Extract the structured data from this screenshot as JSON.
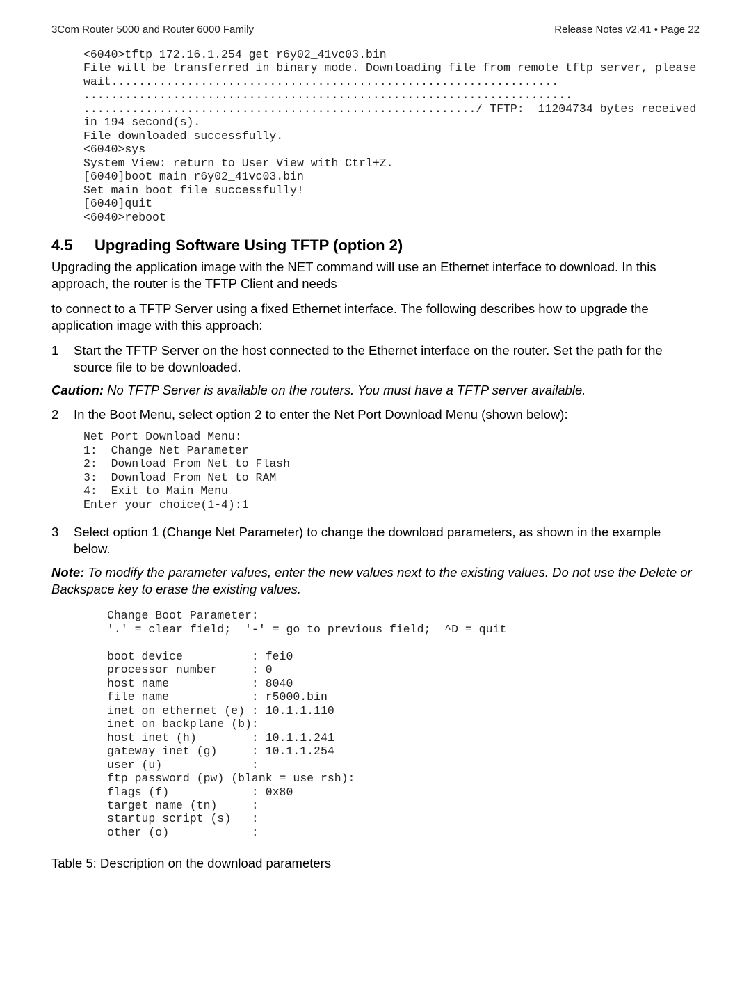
{
  "header": {
    "left": "3Com Router 5000 and Router 6000 Family",
    "right": "Release Notes v2.41 • Page 22"
  },
  "codeblock1": "<6040>tftp 172.16.1.254 get r6y02_41vc03.bin\nFile will be transferred in binary mode. Downloading file from remote tftp server, please wait.................................................................\n.......................................................................\n........................................................./ TFTP:  11204734 bytes received in 194 second(s).\nFile downloaded successfully.\n<6040>sys\nSystem View: return to User View with Ctrl+Z.\n[6040]boot main r6y02_41vc03.bin\nSet main boot file successfully!\n[6040]quit\n<6040>reboot",
  "section": {
    "num": "4.5",
    "title": "Upgrading Software Using TFTP (option 2)"
  },
  "para1": "Upgrading the application image with the NET command will use an Ethernet interface to download. In this approach, the router is the TFTP Client and needs",
  "para2": "to connect to a TFTP Server using a fixed Ethernet interface. The following describes how to upgrade the application image with this approach:",
  "step1": {
    "num": "1",
    "text": "Start the TFTP Server on the host connected to the Ethernet interface on the router. Set the path for the source file to be downloaded."
  },
  "caution": {
    "label": "Caution:",
    "body": " No TFTP Server is available on the routers. You must have a TFTP server available."
  },
  "step2": {
    "num": "2",
    "text": "In the Boot Menu, select option 2 to enter the Net Port Download Menu (shown below):"
  },
  "codeblock2": "Net Port Download Menu:\n1:  Change Net Parameter\n2:  Download From Net to Flash\n3:  Download From Net to RAM\n4:  Exit to Main Menu\nEnter your choice(1-4):1",
  "step3": {
    "num": "3",
    "text": "Select option 1 (Change Net Parameter) to change the download parameters, as shown in the example below."
  },
  "note": {
    "label": "Note:",
    "body": " To modify the parameter values, enter the new values next to the existing values. Do not use the Delete or Backspace key to erase the existing values."
  },
  "codeblock3": "Change Boot Parameter:\n'.' = clear field;  '-' = go to previous field;  ^D = quit\n\nboot device          : fei0\nprocessor number     : 0\nhost name            : 8040\nfile name            : r5000.bin\ninet on ethernet (e) : 10.1.1.110\ninet on backplane (b):\nhost inet (h)        : 10.1.1.241\ngateway inet (g)     : 10.1.1.254\nuser (u)             :\nftp password (pw) (blank = use rsh):\nflags (f)            : 0x80\ntarget name (tn)     :\nstartup script (s)   :\nother (o)            :",
  "tablecaption": "Table 5: Description on the download parameters"
}
